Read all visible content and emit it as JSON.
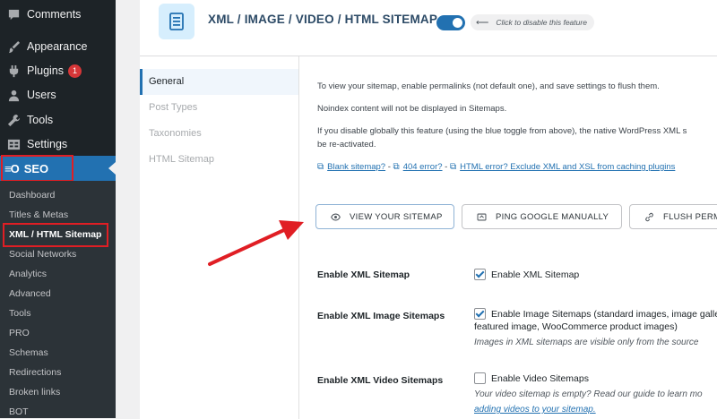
{
  "sidebar": {
    "menu": [
      {
        "label": "Comments",
        "icon": "comment-icon"
      },
      {
        "label": "Appearance",
        "icon": "paintbrush-icon"
      },
      {
        "label": "Plugins",
        "icon": "plugin-icon",
        "badge": "1"
      },
      {
        "label": "Users",
        "icon": "users-icon"
      },
      {
        "label": "Tools",
        "icon": "wrench-icon"
      },
      {
        "label": "Settings",
        "icon": "settings-icon"
      }
    ],
    "seo": {
      "logo": "≡O",
      "label": "SEO"
    },
    "submenu": [
      "Dashboard",
      "Titles & Metas",
      "XML / HTML Sitemap",
      "Social Networks",
      "Analytics",
      "Advanced",
      "Tools",
      "PRO",
      "Schemas",
      "Redirections",
      "Broken links",
      "BOT"
    ]
  },
  "header": {
    "title": "XML / IMAGE / VIDEO / HTML SITEMAP",
    "toggle_on": true,
    "toggle_hint": "Click to disable this feature"
  },
  "tabs": [
    "General",
    "Post Types",
    "Taxonomies",
    "HTML Sitemap"
  ],
  "info": {
    "line1": "To view your sitemap, enable permalinks (not default one), and save settings to flush them.",
    "line2": "Noindex content will not be displayed in Sitemaps.",
    "line3a": "If you disable globally this feature (using the blue toggle from above), the native WordPress XML s",
    "line3b": "be re-activated.",
    "link1": "Blank sitemap?",
    "link2": "404 error?",
    "link3": "HTML error? Exclude XML and XSL from caching plugins",
    "sep": " - "
  },
  "buttons": {
    "view": "VIEW YOUR SITEMAP",
    "ping": "PING GOOGLE MANUALLY",
    "flush": "FLUSH PERMALINKS"
  },
  "settings": {
    "xml": {
      "label": "Enable XML Sitemap",
      "checkbox": "Enable XML Sitemap",
      "checked": true
    },
    "image": {
      "label": "Enable XML Image Sitemaps",
      "checkbox": "Enable Image Sitemaps (standard images, image gallerie",
      "checkbox_cont": "featured image, WooCommerce product images)",
      "desc": "Images in XML sitemaps are visible only from the source",
      "checked": true
    },
    "video": {
      "label": "Enable XML Video Sitemaps",
      "checkbox": "Enable Video Sitemaps",
      "desc": "Your video sitemap is empty? Read our guide to learn mo",
      "link": "adding videos to your sitemap.",
      "checked": false
    }
  },
  "colors": {
    "accent": "#2271b1",
    "highlight": "#e01e24",
    "sidebar": "#1d2327"
  }
}
